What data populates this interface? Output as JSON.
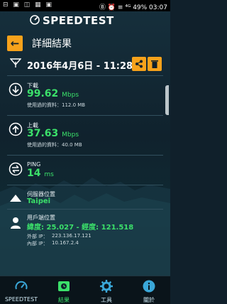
{
  "status": {
    "left_icons": "⊟ ▣ ◫ ▦ ▣",
    "right": "Ⓑ ⏰ ≡ ⁴ᴳ 49% 03:07"
  },
  "app": {
    "brand": "SPEEDTEST"
  },
  "header": {
    "title": "詳細結果"
  },
  "result": {
    "date": "2016年4月6日 - 11:28"
  },
  "download": {
    "label": "下載",
    "value": "99.62",
    "unit": "Mbps",
    "data_used": "使用過的資料：112.0 MB"
  },
  "upload": {
    "label": "上載",
    "value": "37.63",
    "unit": "Mbps",
    "data_used": "使用過的資料：40.0 MB"
  },
  "ping": {
    "label": "PING",
    "value": "14",
    "unit": "ms"
  },
  "server": {
    "label": "伺服器位置",
    "value": "Taipei"
  },
  "client": {
    "label": "用戶端位置",
    "coords": "緯度: 25.027 - 經度: 121.518",
    "external_ip_label": "外部 IP：",
    "external_ip": "223.136.17.121",
    "internal_ip_label": "內部 IP：",
    "internal_ip": "10.167.2.4"
  },
  "tabs": [
    {
      "label": "SPEEDTEST",
      "icon": "gauge-icon"
    },
    {
      "label": "結果",
      "icon": "history-icon",
      "active": true
    },
    {
      "label": "工具",
      "icon": "gear-icon"
    },
    {
      "label": "關於",
      "icon": "info-icon"
    }
  ],
  "colors": {
    "accent": "#f7a21b",
    "value_green": "#3be06a",
    "bg": "#10202b"
  }
}
